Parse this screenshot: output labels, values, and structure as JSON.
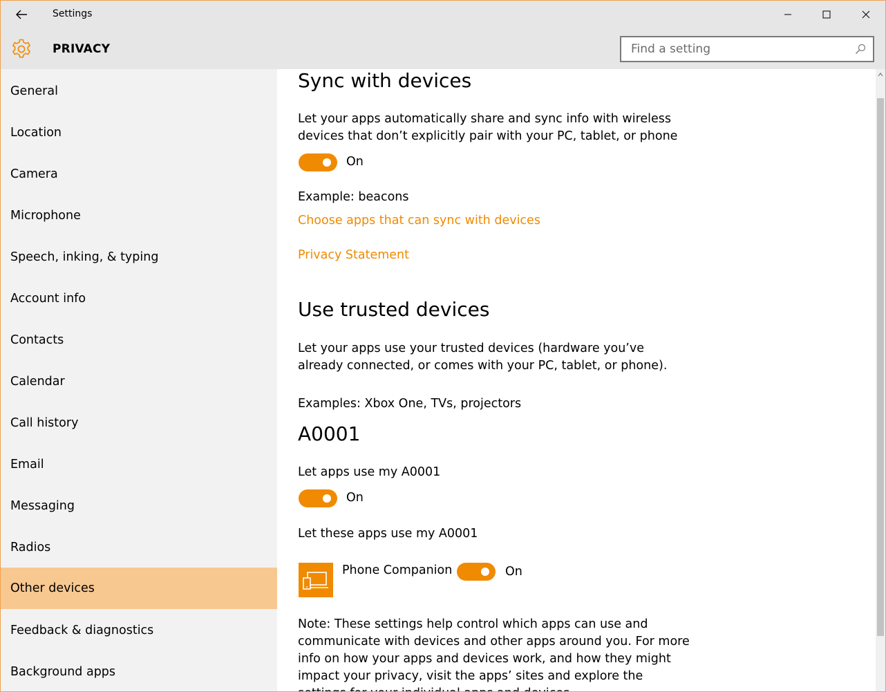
{
  "window": {
    "title": "Settings",
    "accent": "#f08a00",
    "selection": "#f8c891"
  },
  "header": {
    "title": "PRIVACY",
    "icon": "gear-icon",
    "search_placeholder": "Find a setting"
  },
  "sidebar": {
    "items": [
      {
        "label": "General"
      },
      {
        "label": "Location"
      },
      {
        "label": "Camera"
      },
      {
        "label": "Microphone"
      },
      {
        "label": "Speech, inking, & typing"
      },
      {
        "label": "Account info"
      },
      {
        "label": "Contacts"
      },
      {
        "label": "Calendar"
      },
      {
        "label": "Call history"
      },
      {
        "label": "Email"
      },
      {
        "label": "Messaging"
      },
      {
        "label": "Radios"
      },
      {
        "label": "Other devices",
        "selected": true
      },
      {
        "label": "Feedback & diagnostics"
      },
      {
        "label": "Background apps"
      }
    ]
  },
  "content": {
    "sync": {
      "heading": "Sync with devices",
      "description": "Let your apps automatically share and sync info with wireless devices that don’t explicitly pair with your PC, tablet, or phone",
      "toggle_state": "On",
      "example": "Example: beacons",
      "choose_link": "Choose apps that can sync with devices",
      "privacy_link": "Privacy Statement"
    },
    "trusted": {
      "heading": "Use trusted devices",
      "description": "Let your apps use your trusted devices (hardware you’ve already connected, or comes with your PC, tablet, or phone).",
      "examples": "Examples: Xbox One, TVs, projectors",
      "device_name": "A0001",
      "let_apps_label": "Let apps use my A0001",
      "let_apps_toggle_state": "On",
      "these_apps_label": "Let these apps use my A0001",
      "apps": [
        {
          "name": "Phone Companion",
          "toggle_state": "On",
          "icon": "phone-companion-icon"
        }
      ],
      "note": "Note: These settings help control which apps can use and communicate with devices and other apps around you. For more info on how your apps and devices work, and how they might impact your privacy, visit the apps’ sites and explore the settings for your individual apps and devices."
    }
  }
}
